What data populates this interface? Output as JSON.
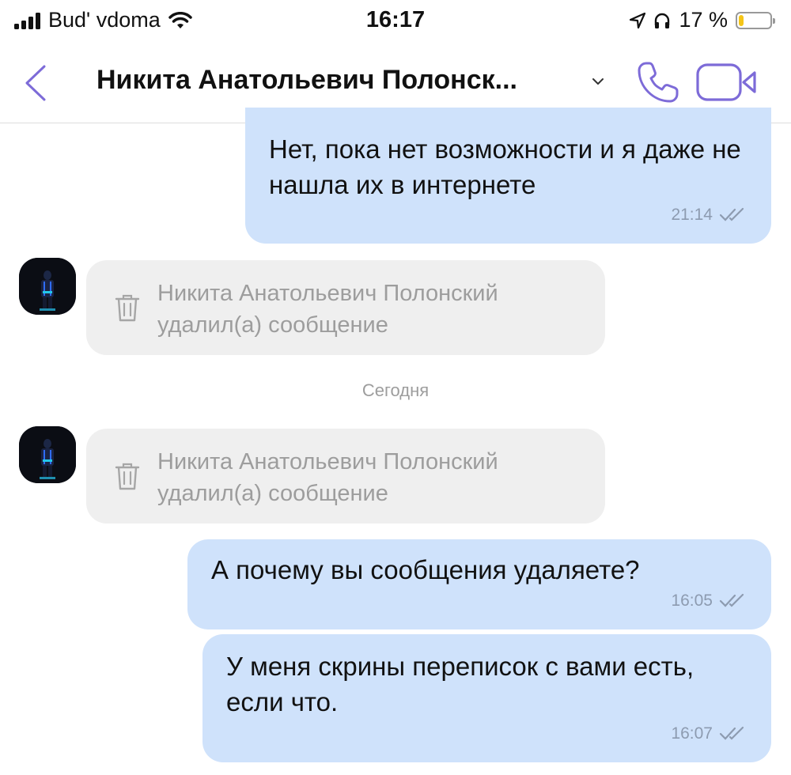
{
  "status_bar": {
    "carrier": "Bud' vdoma",
    "time": "16:17",
    "battery_percent": "17 %",
    "battery_level": 0.17
  },
  "header": {
    "title": "Никита Анатольевич Полонск...",
    "accent_color": "#7d6bd8"
  },
  "messages": [
    {
      "type": "outgoing",
      "text": "Нет, пока нет возможности и я даже не нашла их в интернете",
      "time": "21:14"
    },
    {
      "type": "deleted",
      "text": "Никита Анатольевич Полонский удалил(а) сообщение"
    },
    {
      "type": "date",
      "text": "Сегодня"
    },
    {
      "type": "deleted",
      "text": "Никита Анатольевич Полонский удалил(а) сообщение"
    },
    {
      "type": "outgoing",
      "text": "А почему вы сообщения удаляете?",
      "time": "16:05"
    },
    {
      "type": "outgoing",
      "text": "У меня скрины переписок с вами есть, если что.",
      "time": "16:07"
    }
  ],
  "colors": {
    "outgoing_bubble": "#cfe2fb",
    "deleted_bubble": "#efefef",
    "meta_text": "#8d9bb0"
  },
  "icons": [
    "back-chevron-icon",
    "dropdown-chevron-icon",
    "phone-icon",
    "video-camera-icon",
    "trash-icon",
    "double-check-icon"
  ]
}
